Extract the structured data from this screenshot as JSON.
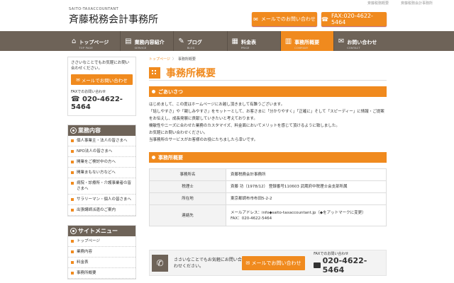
{
  "topbar": {
    "note1": "斉藤税務概要",
    "note2": "斉藤税務会計事務所"
  },
  "logo": {
    "sub": "SAITO-TAXACCOUNTANT",
    "main": "斉藤税務会計事務所"
  },
  "header": {
    "mail_label": "メールでのお問い合わせ",
    "fax_label": "FAX:020-4622-5464"
  },
  "nav": [
    {
      "label": "トップページ",
      "sub": "TOP PAGE",
      "icon": "home-icon"
    },
    {
      "label": "業務内容紹介",
      "sub": "SERVICE",
      "icon": "book-icon"
    },
    {
      "label": "ブログ",
      "sub": "BLOG",
      "icon": "pencil-icon"
    },
    {
      "label": "料金表",
      "sub": "PRICE",
      "icon": "calculator-icon"
    },
    {
      "label": "事務所概要",
      "sub": "COMPANY",
      "icon": "building-icon"
    },
    {
      "label": "お問い合わせ",
      "sub": "CONTACT",
      "icon": "mail-icon"
    }
  ],
  "sidebar": {
    "cta_text": "ささいなことでもお気軽にお問い合わせください。",
    "cta_btn": "メールでお問い合わせ",
    "fax_label": "FAXでのお問い合わせ",
    "fax_num": "020-4622-5464",
    "services_title": "業務内容",
    "services": [
      "個人事業主・法人の皆さまへ",
      "NPO法人の皆さまへ",
      "開業をご検討中の方へ",
      "開業まもない方などへ",
      "病院・診療所・介護事業者の皆さまへ",
      "サラリーマン・個人の皆さまへ",
      "出張講師派遣のご案内"
    ],
    "menu_title": "サイトメニュー",
    "menu": [
      "トップページ",
      "業務内容",
      "料金表",
      "事務所概要"
    ]
  },
  "main": {
    "crumb_home": "トップページ",
    "crumb_sep": "〉",
    "crumb_cur": "事務所概要",
    "title": "事務所概要",
    "greet_title": "ごあいさつ",
    "greet_lines": [
      "はじめまして、この度はホームページにお越し頂きまして有難うございます。",
      "「話しやすさ」や「親しみやすさ」をモットーとして、お客さまに「分かりやすく」「正確に」そして「スピーディー」に情報・ご提案をお伝えし、成長発展に貢献していきたいと考えております。",
      "機敏性やニーズに合わせた業務のカスタマイズ、料金面においてメリットを感じて頂けるように致しました。",
      "お気軽にお問い合わせください。",
      "当事務所のサービスがお客様のお役にたちましたら幸いです。"
    ],
    "outline_title": "事務所概要",
    "table": [
      {
        "k": "事務所名",
        "v": "斉藤税務会計事務所"
      },
      {
        "k": "税理士",
        "v": "斉藤 功（1978/12） 登録番号110603 武蔵府中税理士会支部所属"
      },
      {
        "k": "所在地",
        "v": "東京都調布市布田5-2-2"
      },
      {
        "k": "連絡先",
        "v": "メールアドレス：info◆saito-taxaccountant.jp（◆をアットマークに変更）",
        "v2": "FAX：020-4622-5464"
      }
    ]
  },
  "footer": {
    "text": "ささいなことでもお気軽にお問い合わせください。",
    "btn": "メールでお問い合わせ",
    "fax_label": "FAXでのお問い合わせ",
    "fax_num": "020-4622-5464"
  }
}
